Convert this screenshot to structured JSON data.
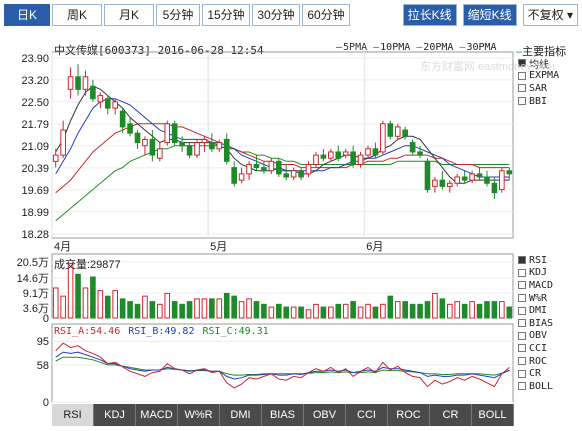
{
  "toolbar": {
    "periods": [
      "日K",
      "周K",
      "月K",
      "5分钟",
      "15分钟",
      "30分钟",
      "60分钟"
    ],
    "active_period": "日K",
    "right_buttons": [
      "拉长K线",
      "缩短K线"
    ],
    "adjust_select": "不复权",
    "colors": {
      "accent": "#2a5ea8"
    }
  },
  "chart": {
    "title": "中文传媒[600373] 2016-06-28 12:54",
    "ma_legend": [
      {
        "label": "5PMA",
        "color": "#333333"
      },
      {
        "label": "10PMA",
        "color": "#1f3fbf"
      },
      {
        "label": "20PMA",
        "color": "#c8262c"
      },
      {
        "label": "30PMA",
        "color": "#1f8a2a"
      }
    ],
    "main_indicator_label": "主要指标",
    "main_indicators": [
      {
        "label": "均线",
        "checked": true
      },
      {
        "label": "EXPMA",
        "checked": false
      },
      {
        "label": "SAR",
        "checked": false
      },
      {
        "label": "BBI",
        "checked": false
      }
    ],
    "y_ticks": [
      "23.90",
      "23.20",
      "22.50",
      "21.79",
      "21.09",
      "20.39",
      "19.69",
      "18.99",
      "18.28"
    ],
    "x_ticks": [
      "4月",
      "5月",
      "6月"
    ],
    "watermark": "东方财富网 eastmoney.com"
  },
  "volume": {
    "label": "成交量:29877",
    "y_ticks": [
      "20.5万",
      "14.6万",
      "9.1万",
      "3.6万",
      "0"
    ]
  },
  "rsi": {
    "rsi_a": "RSI_A:54.46",
    "rsi_b": "RSI_B:49.82",
    "rsi_c": "RSI_C:49.31",
    "y_ticks": [
      "95",
      "58",
      "0"
    ],
    "colors": {
      "a": "#c8262c",
      "b": "#1f3fbf",
      "c": "#1f8a2a"
    }
  },
  "sub_indicators": [
    {
      "label": "RSI",
      "checked": true
    },
    {
      "label": "KDJ",
      "checked": false
    },
    {
      "label": "MACD",
      "checked": false
    },
    {
      "label": "W%R",
      "checked": false
    },
    {
      "label": "DMI",
      "checked": false
    },
    {
      "label": "BIAS",
      "checked": false
    },
    {
      "label": "OBV",
      "checked": false
    },
    {
      "label": "CCI",
      "checked": false
    },
    {
      "label": "ROC",
      "checked": false
    },
    {
      "label": "CR",
      "checked": false
    },
    {
      "label": "BOLL",
      "checked": false
    }
  ],
  "bottom_tabs": [
    "RSI",
    "KDJ",
    "MACD",
    "W%R",
    "DMI",
    "BIAS",
    "OBV",
    "CCI",
    "ROC",
    "CR",
    "BOLL"
  ],
  "active_bottom_tab": "RSI",
  "chart_data": {
    "type": "candlestick",
    "title": "中文传媒[600373] 2016-06-28 12:54",
    "ylim": [
      18.28,
      23.9
    ],
    "x_ticks": [
      "4月",
      "5月",
      "6月"
    ],
    "candles": [
      {
        "o": 20.6,
        "h": 21.0,
        "l": 20.4,
        "c": 20.8
      },
      {
        "o": 20.8,
        "h": 21.9,
        "l": 20.7,
        "c": 21.6
      },
      {
        "o": 22.9,
        "h": 23.6,
        "l": 22.6,
        "c": 23.3
      },
      {
        "o": 23.3,
        "h": 23.7,
        "l": 22.7,
        "c": 22.9
      },
      {
        "o": 22.9,
        "h": 23.5,
        "l": 22.7,
        "c": 23.3
      },
      {
        "o": 23.0,
        "h": 23.2,
        "l": 22.5,
        "c": 22.6
      },
      {
        "o": 22.5,
        "h": 22.8,
        "l": 22.3,
        "c": 22.7
      },
      {
        "o": 22.6,
        "h": 22.7,
        "l": 22.1,
        "c": 22.3
      },
      {
        "o": 22.3,
        "h": 22.6,
        "l": 22.1,
        "c": 22.5
      },
      {
        "o": 22.2,
        "h": 22.3,
        "l": 21.5,
        "c": 21.7
      },
      {
        "o": 21.8,
        "h": 22.0,
        "l": 21.4,
        "c": 21.5
      },
      {
        "o": 21.5,
        "h": 21.6,
        "l": 21.0,
        "c": 21.2
      },
      {
        "o": 21.1,
        "h": 21.4,
        "l": 20.8,
        "c": 21.3
      },
      {
        "o": 21.3,
        "h": 21.6,
        "l": 20.6,
        "c": 20.8
      },
      {
        "o": 20.7,
        "h": 21.2,
        "l": 20.6,
        "c": 21.0
      },
      {
        "o": 21.2,
        "h": 21.9,
        "l": 21.1,
        "c": 21.8
      },
      {
        "o": 21.8,
        "h": 21.9,
        "l": 21.1,
        "c": 21.2
      },
      {
        "o": 21.2,
        "h": 21.4,
        "l": 20.9,
        "c": 21.1
      },
      {
        "o": 21.1,
        "h": 21.2,
        "l": 20.7,
        "c": 20.8
      },
      {
        "o": 20.8,
        "h": 21.3,
        "l": 20.7,
        "c": 21.2
      },
      {
        "o": 21.2,
        "h": 21.4,
        "l": 20.9,
        "c": 21.3
      },
      {
        "o": 21.2,
        "h": 21.5,
        "l": 20.9,
        "c": 21.0
      },
      {
        "o": 21.0,
        "h": 21.3,
        "l": 20.9,
        "c": 21.2
      },
      {
        "o": 21.3,
        "h": 21.5,
        "l": 20.5,
        "c": 20.6
      },
      {
        "o": 20.4,
        "h": 20.6,
        "l": 19.8,
        "c": 19.9
      },
      {
        "o": 20.0,
        "h": 20.4,
        "l": 19.9,
        "c": 20.2
      },
      {
        "o": 20.2,
        "h": 20.6,
        "l": 20.0,
        "c": 20.5
      },
      {
        "o": 20.5,
        "h": 20.8,
        "l": 20.3,
        "c": 20.4
      },
      {
        "o": 20.4,
        "h": 20.6,
        "l": 20.2,
        "c": 20.3
      },
      {
        "o": 20.3,
        "h": 20.7,
        "l": 20.2,
        "c": 20.6
      },
      {
        "o": 20.6,
        "h": 20.7,
        "l": 20.1,
        "c": 20.2
      },
      {
        "o": 20.2,
        "h": 20.5,
        "l": 20.0,
        "c": 20.1
      },
      {
        "o": 20.1,
        "h": 20.4,
        "l": 20.0,
        "c": 20.3
      },
      {
        "o": 20.3,
        "h": 20.4,
        "l": 20.0,
        "c": 20.1
      },
      {
        "o": 20.2,
        "h": 20.6,
        "l": 20.1,
        "c": 20.5
      },
      {
        "o": 20.5,
        "h": 20.9,
        "l": 20.4,
        "c": 20.8
      },
      {
        "o": 20.8,
        "h": 21.0,
        "l": 20.6,
        "c": 20.7
      },
      {
        "o": 20.7,
        "h": 21.0,
        "l": 20.6,
        "c": 20.9
      },
      {
        "o": 20.9,
        "h": 21.1,
        "l": 20.6,
        "c": 20.7
      },
      {
        "o": 20.8,
        "h": 21.0,
        "l": 20.7,
        "c": 20.9
      },
      {
        "o": 20.9,
        "h": 21.1,
        "l": 20.4,
        "c": 20.5
      },
      {
        "o": 20.5,
        "h": 20.9,
        "l": 20.4,
        "c": 20.8
      },
      {
        "o": 20.8,
        "h": 21.1,
        "l": 20.7,
        "c": 21.0
      },
      {
        "o": 21.0,
        "h": 21.2,
        "l": 20.7,
        "c": 20.8
      },
      {
        "o": 20.9,
        "h": 21.9,
        "l": 20.8,
        "c": 21.8
      },
      {
        "o": 21.8,
        "h": 21.9,
        "l": 21.3,
        "c": 21.4
      },
      {
        "o": 21.4,
        "h": 21.8,
        "l": 21.3,
        "c": 21.7
      },
      {
        "o": 21.6,
        "h": 21.7,
        "l": 21.3,
        "c": 21.4
      },
      {
        "o": 21.2,
        "h": 21.3,
        "l": 20.8,
        "c": 20.9
      },
      {
        "o": 20.9,
        "h": 21.1,
        "l": 20.7,
        "c": 20.8
      },
      {
        "o": 20.6,
        "h": 20.7,
        "l": 19.6,
        "c": 19.7
      },
      {
        "o": 19.8,
        "h": 20.1,
        "l": 19.6,
        "c": 20.0
      },
      {
        "o": 20.0,
        "h": 20.3,
        "l": 19.7,
        "c": 19.8
      },
      {
        "o": 19.8,
        "h": 20.0,
        "l": 19.6,
        "c": 19.9
      },
      {
        "o": 19.9,
        "h": 20.2,
        "l": 19.8,
        "c": 20.1
      },
      {
        "o": 20.1,
        "h": 20.3,
        "l": 19.9,
        "c": 20.0
      },
      {
        "o": 20.0,
        "h": 20.3,
        "l": 19.9,
        "c": 20.2
      },
      {
        "o": 20.2,
        "h": 20.4,
        "l": 20.0,
        "c": 20.1
      },
      {
        "o": 20.1,
        "h": 20.3,
        "l": 19.8,
        "c": 19.9
      },
      {
        "o": 19.9,
        "h": 20.1,
        "l": 19.4,
        "c": 19.6
      },
      {
        "o": 19.7,
        "h": 20.4,
        "l": 19.6,
        "c": 20.3
      },
      {
        "o": 20.3,
        "h": 20.4,
        "l": 20.0,
        "c": 20.2
      }
    ],
    "ma5": [
      20.9,
      21.3,
      21.9,
      22.4,
      22.8,
      23.0,
      22.9,
      22.7,
      22.5,
      22.3,
      22.0,
      21.8,
      21.6,
      21.4,
      21.2,
      21.3,
      21.3,
      21.2,
      21.2,
      21.2,
      21.2,
      21.2,
      21.1,
      21.0,
      20.7,
      20.5,
      20.4,
      20.3,
      20.3,
      20.3,
      20.4,
      20.3,
      20.3,
      20.2,
      20.2,
      20.3,
      20.5,
      20.6,
      20.7,
      20.8,
      20.8,
      20.7,
      20.7,
      20.8,
      21.0,
      21.1,
      21.3,
      21.4,
      21.4,
      21.3,
      21.0,
      20.7,
      20.4,
      20.1,
      19.9,
      19.9,
      20.0,
      20.0,
      20.0,
      20.0,
      20.0,
      20.0
    ],
    "ma10": [
      20.2,
      20.6,
      21.0,
      21.5,
      21.9,
      22.3,
      22.5,
      22.6,
      22.6,
      22.5,
      22.4,
      22.2,
      22.0,
      21.8,
      21.6,
      21.5,
      21.4,
      21.3,
      21.3,
      21.3,
      21.3,
      21.2,
      21.2,
      21.1,
      21.0,
      20.8,
      20.7,
      20.6,
      20.5,
      20.4,
      20.3,
      20.3,
      20.3,
      20.3,
      20.3,
      20.3,
      20.3,
      20.4,
      20.4,
      20.5,
      20.6,
      20.6,
      20.7,
      20.7,
      20.8,
      20.9,
      21.0,
      21.1,
      21.1,
      21.0,
      20.9,
      20.8,
      20.7,
      20.5,
      20.4,
      20.3,
      20.2,
      20.1,
      20.1,
      20.1,
      20.1,
      20.1
    ],
    "ma20": [
      19.6,
      19.8,
      20.0,
      20.3,
      20.6,
      20.9,
      21.1,
      21.3,
      21.5,
      21.6,
      21.7,
      21.8,
      21.8,
      21.8,
      21.8,
      21.8,
      21.7,
      21.7,
      21.6,
      21.5,
      21.4,
      21.3,
      21.2,
      21.1,
      21.0,
      20.9,
      20.8,
      20.7,
      20.6,
      20.6,
      20.5,
      20.5,
      20.5,
      20.4,
      20.4,
      20.4,
      20.4,
      20.4,
      20.4,
      20.4,
      20.5,
      20.5,
      20.6,
      20.6,
      20.6,
      20.7,
      20.7,
      20.8,
      20.8,
      20.8,
      20.8,
      20.7,
      20.7,
      20.6,
      20.5,
      20.5,
      20.5,
      20.4,
      20.4,
      20.4,
      20.4,
      20.4
    ],
    "ma30": [
      18.7,
      18.9,
      19.1,
      19.3,
      19.5,
      19.7,
      19.9,
      20.1,
      20.3,
      20.4,
      20.6,
      20.7,
      20.8,
      20.9,
      21.0,
      21.0,
      21.1,
      21.1,
      21.1,
      21.1,
      21.1,
      21.1,
      21.1,
      21.0,
      21.0,
      20.9,
      20.9,
      20.8,
      20.8,
      20.7,
      20.7,
      20.6,
      20.6,
      20.5,
      20.5,
      20.5,
      20.5,
      20.5,
      20.5,
      20.5,
      20.5,
      20.5,
      20.5,
      20.5,
      20.5,
      20.5,
      20.6,
      20.6,
      20.6,
      20.6,
      20.6,
      20.6,
      20.5,
      20.5,
      20.5,
      20.5,
      20.5,
      20.5,
      20.5,
      20.5,
      20.5,
      20.5
    ],
    "volume": [
      11,
      8,
      20,
      16,
      11,
      15,
      10,
      8,
      10,
      7,
      6,
      5,
      8,
      6,
      5,
      9,
      6,
      5,
      6,
      7,
      7,
      7,
      7,
      9,
      8,
      6,
      7,
      6,
      5,
      4,
      5,
      4,
      4,
      4,
      3,
      5,
      4,
      4,
      5,
      5,
      6,
      4,
      5,
      4,
      5,
      8,
      6,
      6,
      5,
      5,
      6,
      9,
      7,
      5,
      6,
      5,
      6,
      5,
      6,
      6,
      6,
      4
    ],
    "volume_ylim": [
      0,
      20.5
    ],
    "rsi_a": [
      80,
      92,
      85,
      88,
      80,
      76,
      70,
      60,
      62,
      55,
      48,
      44,
      40,
      46,
      48,
      60,
      52,
      50,
      44,
      50,
      52,
      46,
      48,
      30,
      22,
      28,
      38,
      36,
      40,
      44,
      36,
      34,
      40,
      38,
      46,
      52,
      48,
      54,
      46,
      52,
      40,
      48,
      54,
      46,
      62,
      50,
      56,
      46,
      40,
      38,
      24,
      34,
      28,
      32,
      38,
      34,
      40,
      36,
      30,
      24,
      44,
      54
    ],
    "rsi_b": [
      70,
      78,
      76,
      78,
      74,
      70,
      66,
      60,
      60,
      56,
      52,
      50,
      48,
      50,
      50,
      54,
      52,
      50,
      48,
      50,
      50,
      48,
      48,
      40,
      36,
      38,
      42,
      42,
      43,
      44,
      42,
      42,
      44,
      43,
      46,
      48,
      48,
      50,
      48,
      50,
      46,
      48,
      50,
      48,
      54,
      52,
      52,
      50,
      48,
      46,
      40,
      42,
      40,
      40,
      42,
      42,
      44,
      42,
      40,
      38,
      44,
      50
    ],
    "rsi_c": [
      64,
      70,
      70,
      70,
      68,
      66,
      62,
      58,
      58,
      56,
      54,
      52,
      50,
      50,
      50,
      52,
      51,
      50,
      49,
      49,
      49,
      48,
      48,
      44,
      42,
      42,
      43,
      43,
      44,
      44,
      44,
      44,
      44,
      44,
      45,
      46,
      46,
      47,
      46,
      47,
      46,
      46,
      47,
      46,
      50,
      49,
      49,
      48,
      47,
      46,
      44,
      44,
      43,
      43,
      44,
      44,
      44,
      44,
      43,
      42,
      45,
      49
    ],
    "rsi_ylim": [
      0,
      100
    ]
  }
}
